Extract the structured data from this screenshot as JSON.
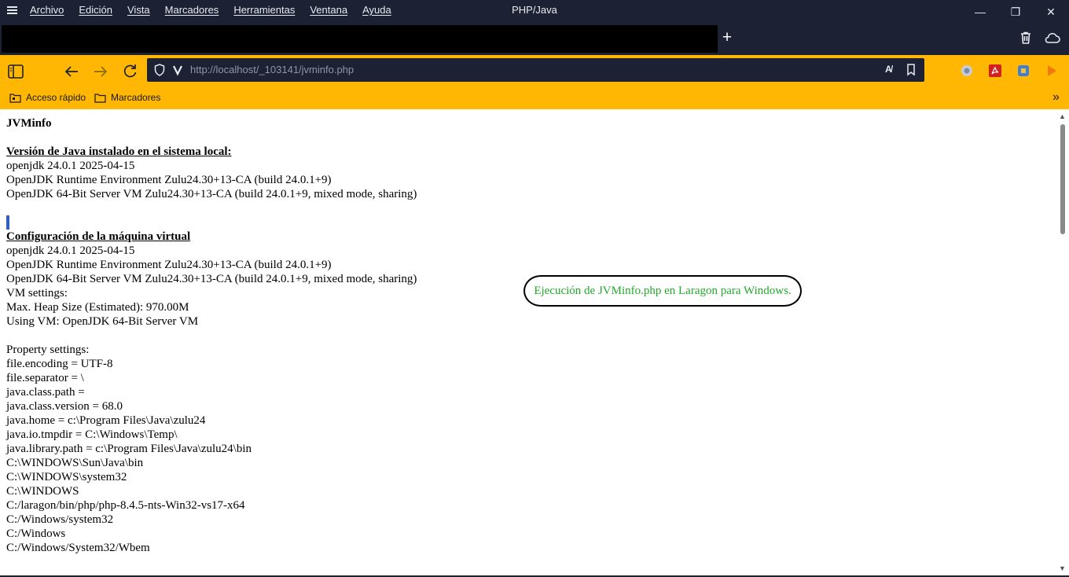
{
  "window": {
    "title": "PHP/Java",
    "menu": [
      "Archivo",
      "Edición",
      "Vista",
      "Marcadores",
      "Herramientas",
      "Ventana",
      "Ayuda"
    ],
    "controls": {
      "minimize": "—",
      "maximize": "❐",
      "close": "✕"
    }
  },
  "tabs": {
    "new_tab": "+"
  },
  "nav": {
    "url": "http://localhost/_103141/jvminfo.php",
    "translate": "A̸"
  },
  "bookmarks": {
    "items": [
      "Acceso rápido",
      "Marcadores"
    ],
    "more": "»"
  },
  "page": {
    "heading": "JVMinfo",
    "section1_title": "Versión de Java instalado en el sistema local:",
    "section1_lines": [
      "openjdk 24.0.1 2025-04-15",
      "OpenJDK Runtime Environment Zulu24.30+13-CA (build 24.0.1+9)",
      "OpenJDK 64-Bit Server VM Zulu24.30+13-CA (build 24.0.1+9, mixed mode, sharing)"
    ],
    "section2_title": "Configuración de la máquina virtual",
    "section2_lines": [
      "openjdk 24.0.1 2025-04-15",
      "OpenJDK Runtime Environment Zulu24.30+13-CA (build 24.0.1+9)",
      "OpenJDK 64-Bit Server VM Zulu24.30+13-CA (build 24.0.1+9, mixed mode, sharing)",
      "VM settings:",
      "Max. Heap Size (Estimated): 970.00M",
      "Using VM: OpenJDK 64-Bit Server VM",
      "",
      "Property settings:",
      "file.encoding = UTF-8",
      "file.separator = \\",
      "java.class.path =",
      "java.class.version = 68.0",
      "java.home = c:\\Program Files\\Java\\zulu24",
      "java.io.tmpdir = C:\\Windows\\Temp\\",
      "java.library.path = c:\\Program Files\\Java\\zulu24\\bin",
      "C:\\WINDOWS\\Sun\\Java\\bin",
      "C:\\WINDOWS\\system32",
      "C:\\WINDOWS",
      "C:/laragon/bin/php/php-8.4.5-nts-Win32-vs17-x64",
      "C:/Windows/system32",
      "C:/Windows",
      "C:/Windows/System32/Wbem"
    ],
    "annotation": "Ejecución de JVMinfo.php en Laragon para Windows."
  },
  "colors": {
    "chrome_dark": "#1c2233",
    "accent_yellow": "#ffb703",
    "annotation_text": "#22aa2a"
  },
  "icons": [
    "hamburger-menu-icon",
    "new-tab-icon",
    "trash-icon",
    "cloud-icon",
    "sidebar-toggle-icon",
    "back-icon",
    "forward-icon",
    "reload-icon",
    "shield-icon",
    "vivaldi-icon",
    "translate-icon",
    "bookmark-icon",
    "extension-icon",
    "folder-icon"
  ]
}
